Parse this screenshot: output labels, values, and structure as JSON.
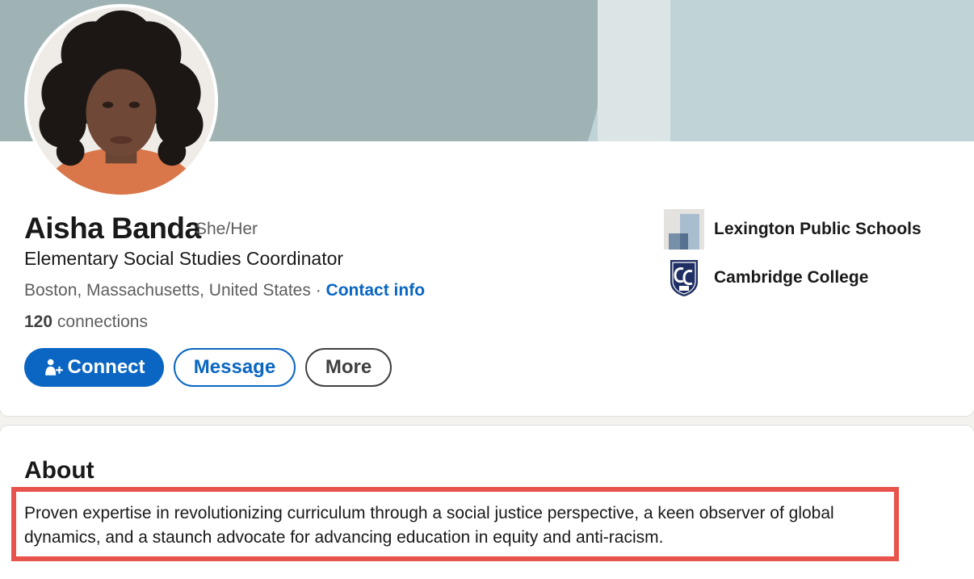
{
  "profile": {
    "name": "Aisha Banda",
    "pronouns": "She/Her",
    "headline": "Elementary Social Studies Coordinator",
    "location": "Boston, Massachusetts, United States",
    "separator": "·",
    "contact_label": "Contact info",
    "connections_count": "120",
    "connections_label": "connections"
  },
  "actions": {
    "connect_label": "Connect",
    "message_label": "Message",
    "more_label": "More"
  },
  "organizations": [
    {
      "name": "Lexington Public Schools",
      "logo": "building-logo-icon"
    },
    {
      "name": "Cambridge College",
      "logo": "cc-shield-logo-icon"
    }
  ],
  "about": {
    "title": "About",
    "text": "Proven expertise in revolutionizing curriculum through a social justice perspective, a keen observer of global dynamics, and a staunch advocate for advancing education in equity and anti-racism."
  },
  "colors": {
    "accent": "#0a66c2",
    "highlight": "#e8534b",
    "cover_light": "#c0d3d6",
    "cover_dark": "#a0b3b4"
  }
}
